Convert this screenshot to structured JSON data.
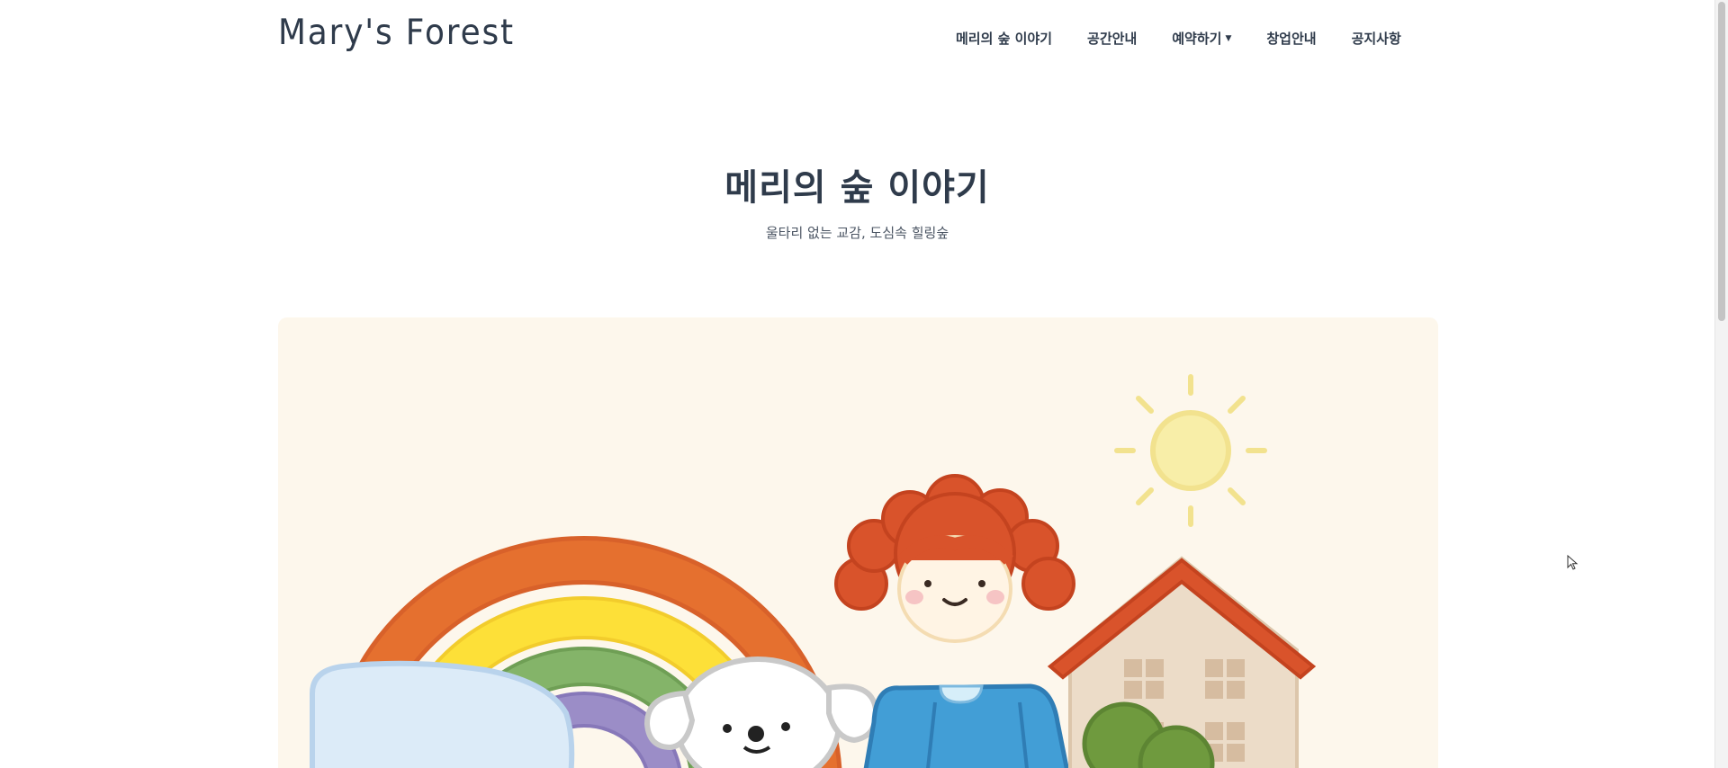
{
  "header": {
    "logo": "Mary's Forest",
    "nav": [
      {
        "label": "메리의 숲 이야기"
      },
      {
        "label": "공간안내"
      },
      {
        "label": "예약하기",
        "has_dropdown": true
      },
      {
        "label": "창업안내"
      },
      {
        "label": "공지사항"
      }
    ]
  },
  "hero": {
    "title": "메리의 숲 이야기",
    "subtitle": "울타리 없는 교감, 도심속 힐링숲"
  },
  "colors": {
    "text": "#2f3b4b",
    "illustration_bg": "#fdf7ec",
    "rainbow": [
      "#e5702f",
      "#fde038",
      "#84b469",
      "#9b8dc7"
    ],
    "sun": "#f8eea8",
    "hair": "#d9532b",
    "dress": "#429ed6",
    "roof": "#d9532b",
    "house": "#ecdcc8",
    "bush": "#6f9a3e"
  },
  "illustration": {
    "icons": [
      "rainbow-icon",
      "cloud-icon",
      "dog-icon",
      "girl-icon",
      "sun-icon",
      "house-icon",
      "bush-icon"
    ]
  }
}
